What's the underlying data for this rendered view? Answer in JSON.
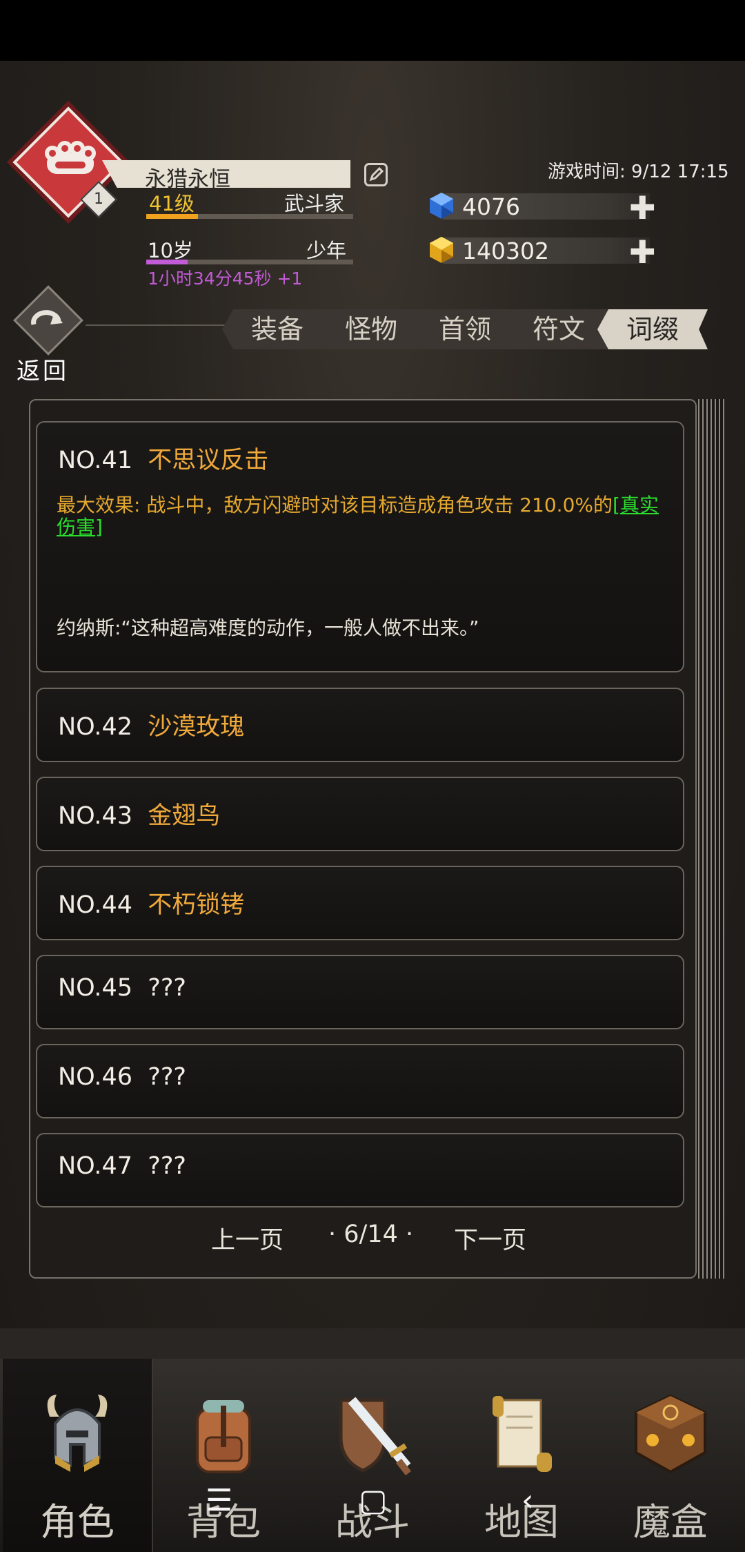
{
  "header": {
    "player_name": "永猎永恒",
    "level": "41级",
    "class": "武斗家",
    "age": "10岁",
    "age_stage": "少年",
    "timer": "1小时34分45秒 +1",
    "emblem_level": "1",
    "game_time": "游戏时间: 9/12 17:15",
    "level_progress": 0.25,
    "age_progress": 0.2
  },
  "resources": {
    "gems": "4076",
    "gold": "140302",
    "plus": "✚"
  },
  "back": {
    "label": "返回",
    "icon": "refresh-arrow"
  },
  "tabs": [
    {
      "label": "装备"
    },
    {
      "label": "怪物"
    },
    {
      "label": "首领"
    },
    {
      "label": "符文"
    },
    {
      "label": "词缀",
      "active": true
    }
  ],
  "entries": [
    {
      "num": "NO.41",
      "title": "不思议反击",
      "effect_prefix": "最大效果: 战斗中，敌方闪避时对该目标造成角色攻击 210.0%的",
      "effect_bracket": "[",
      "effect_tag": "真实伤害",
      "effect_bracket_close": "]",
      "quote": "约纳斯:“这种超高难度的动作，一般人做不出来。”"
    },
    {
      "num": "NO.42",
      "title": "沙漠玫瑰"
    },
    {
      "num": "NO.43",
      "title": "金翅鸟"
    },
    {
      "num": "NO.44",
      "title": "不朽锁铐"
    },
    {
      "num": "NO.45",
      "title": "???"
    },
    {
      "num": "NO.46",
      "title": "???"
    },
    {
      "num": "NO.47",
      "title": "???"
    }
  ],
  "pager": {
    "prev": "上一页",
    "page": "· 6/14 ·",
    "next": "下一页"
  },
  "nav": [
    {
      "label": "角色",
      "icon": "helmet-icon",
      "active": true
    },
    {
      "label": "背包",
      "icon": "backpack-icon"
    },
    {
      "label": "战斗",
      "icon": "sword-shield-icon"
    },
    {
      "label": "地图",
      "icon": "scroll-icon"
    },
    {
      "label": "魔盒",
      "icon": "magic-box-icon"
    }
  ],
  "system_nav": {
    "menu": "☰",
    "home": "▢",
    "back": "‹"
  },
  "colors": {
    "accent_gold": "#f0a93a",
    "level_yellow": "#f0c431",
    "timer_purple": "#c15bd6",
    "true_damage_green": "#29dc2d",
    "emblem_red": "#c9393c"
  }
}
